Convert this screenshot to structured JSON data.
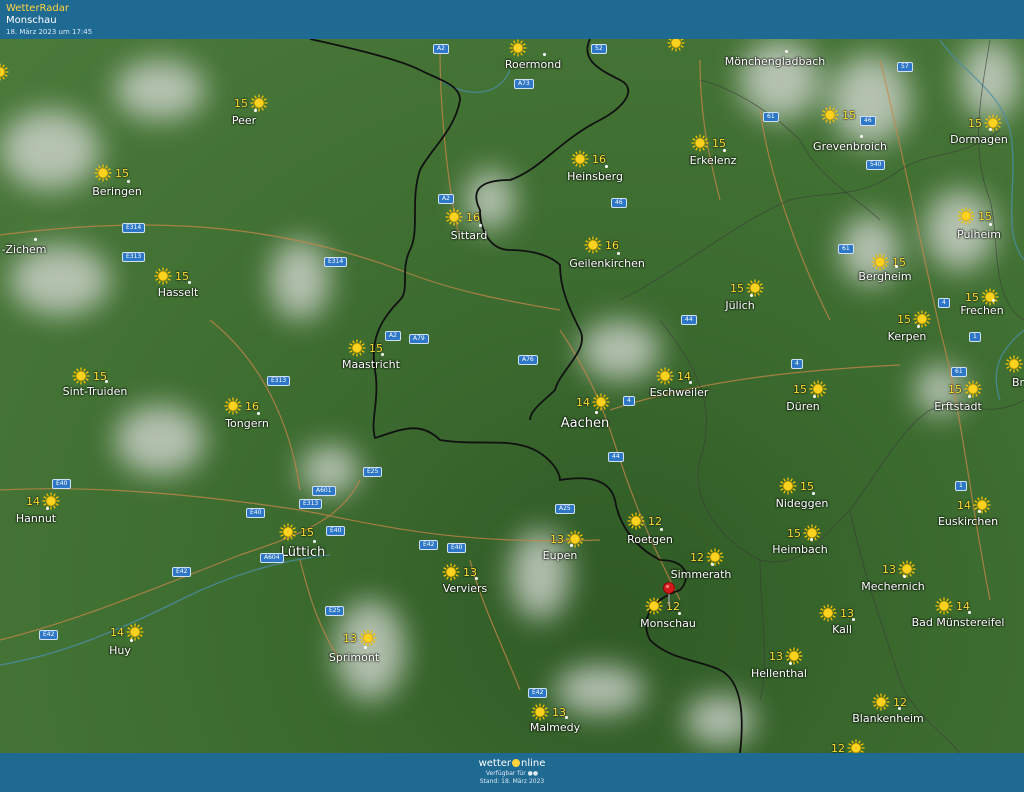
{
  "header": {
    "app": "WetterRadar",
    "location": "Monschau",
    "date": "18. März 2023 um 17:45"
  },
  "footer": {
    "logo_a": "wetter",
    "logo_b": "nline",
    "availability": "Verfügbar für",
    "status": "Stand: 18. März 2023"
  },
  "icons": {
    "weather": "sun-icon",
    "pin": "location-pin-icon",
    "platforms": "apple-android-icons"
  },
  "colors": {
    "bar": "#1e6a93",
    "temperature": "#ffe033",
    "road_shield": "#2e77c6",
    "border": "#111111",
    "road": "#c8874a"
  },
  "cities": [
    {
      "name": "Roermond",
      "temp": ""
    },
    {
      "name": "Mönchengladbach",
      "temp": ""
    },
    {
      "name": "Peer",
      "temp": "15"
    },
    {
      "name": "Beringen",
      "temp": "15"
    },
    {
      "name": "Heinsberg",
      "temp": "16"
    },
    {
      "name": "Erkelenz",
      "temp": "15"
    },
    {
      "name": "Grevenbroich",
      "temp": "15"
    },
    {
      "name": "Dormagen",
      "temp": "15"
    },
    {
      "name": "Sittard",
      "temp": "16"
    },
    {
      "name": "Geilenkirchen",
      "temp": "16"
    },
    {
      "name": "Pulheim",
      "temp": "15"
    },
    {
      "name": "-Zichem",
      "temp": ""
    },
    {
      "name": "Hasselt",
      "temp": "15"
    },
    {
      "name": "Bergheim",
      "temp": "15"
    },
    {
      "name": "Jülich",
      "temp": "15"
    },
    {
      "name": "Frechen",
      "temp": "15"
    },
    {
      "name": "Kerpen",
      "temp": "15"
    },
    {
      "name": "Maastricht",
      "temp": "15"
    },
    {
      "name": "Sint-Truiden",
      "temp": "15"
    },
    {
      "name": "Eschweiler",
      "temp": "14"
    },
    {
      "name": "Düren",
      "temp": "15"
    },
    {
      "name": "Erftstadt",
      "temp": "15"
    },
    {
      "name": "Br",
      "temp": ""
    },
    {
      "name": "Tongern",
      "temp": "16"
    },
    {
      "name": "Aachen",
      "temp": "14"
    },
    {
      "name": "Hannut",
      "temp": "14"
    },
    {
      "name": "Nideggen",
      "temp": "15"
    },
    {
      "name": "Euskirchen",
      "temp": "14"
    },
    {
      "name": "Roetgen",
      "temp": "12"
    },
    {
      "name": "Lüttich",
      "temp": "15"
    },
    {
      "name": "Eupen",
      "temp": "13"
    },
    {
      "name": "Heimbach",
      "temp": "15"
    },
    {
      "name": "Simmerath",
      "temp": "12"
    },
    {
      "name": "Verviers",
      "temp": "13"
    },
    {
      "name": "Mechernich",
      "temp": "13"
    },
    {
      "name": "Monschau",
      "temp": "12"
    },
    {
      "name": "Kall",
      "temp": "13"
    },
    {
      "name": "Bad Münstereifel",
      "temp": "14"
    },
    {
      "name": "Huy",
      "temp": "14"
    },
    {
      "name": "Sprimont",
      "temp": "13"
    },
    {
      "name": "Hellenthal",
      "temp": "13"
    },
    {
      "name": "Blankenheim",
      "temp": "12"
    },
    {
      "name": "Malmedy",
      "temp": "13"
    },
    {
      "name": "",
      "temp": "12"
    }
  ],
  "roads": [
    "A2",
    "52",
    "A73",
    "57",
    "61",
    "46",
    "540",
    "A2",
    "46",
    "E314",
    "E313",
    "E314",
    "61",
    "4",
    "44",
    "A2",
    "A79",
    "A76",
    "4",
    "E313",
    "4",
    "61",
    "44",
    "E25",
    "1",
    "A601",
    "E40",
    "E313",
    "E40",
    "A25",
    "E40",
    "E42",
    "E40",
    "A604",
    "E42",
    "E25",
    "E42",
    "1",
    "E42"
  ]
}
